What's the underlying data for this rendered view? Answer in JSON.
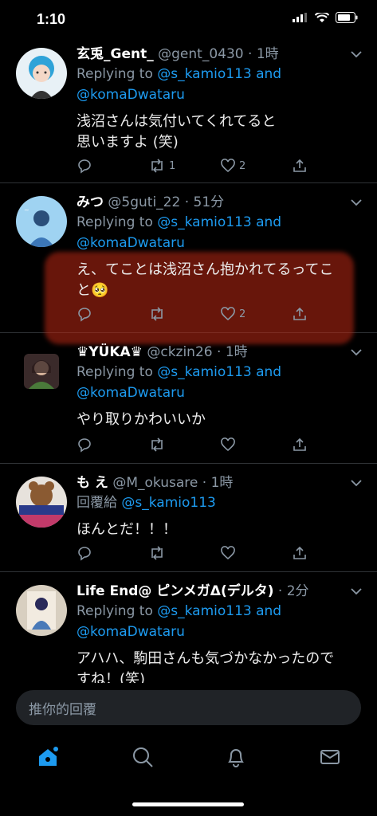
{
  "status": {
    "time": "1:10"
  },
  "tweets": [
    {
      "name": "玄兎_Gent_",
      "handle": "@gent_0430",
      "time": "1時",
      "reply_prefix": "Replying to",
      "mention1": "@s_kamio113",
      "and": "and",
      "mention2": "@komaDwataru",
      "text1": "浅沼さんは気付いてくれてると",
      "text2": "思いますよ (笑)",
      "retweets": "1",
      "likes": "2",
      "avatar_color": "#2fa3d8"
    },
    {
      "name": "みつ",
      "handle": "@5guti_22",
      "time": "51分",
      "reply_prefix": "Replying to",
      "mention1": "@s_kamio113",
      "and": "and",
      "mention2": "@komaDwataru",
      "text1": "え、てことは浅沼さん抱かれてるってこ",
      "text2": "と🥺",
      "retweets": "",
      "likes": "2",
      "avatar_color": "#8cc9ef"
    },
    {
      "name": "♛YÜKA♛",
      "handle": "@ckzin26",
      "time": "1時",
      "reply_prefix": "Replying to",
      "mention1": "@s_kamio113",
      "and": "and",
      "mention2": "@komaDwataru",
      "text1": "やり取りかわいいか",
      "retweets": "",
      "likes": "",
      "avatar_color": "#5a4a4a"
    },
    {
      "name": "も え",
      "handle": "@M_okusare",
      "time": "1時",
      "reply_prefix": "回覆給",
      "mention1": "@s_kamio113",
      "text1": "ほんとだ！！！",
      "retweets": "",
      "likes": "",
      "avatar_color": "#7a5a3a"
    },
    {
      "name": "Life End@ ピンメガΔ(デルタ)",
      "handle": "",
      "time": "2分",
      "reply_prefix": "Replying to",
      "mention1": "@s_kamio113",
      "and": "and",
      "mention2": "@komaDwataru",
      "text1": "アハハ、駒田さんも気づかなかったので",
      "text2": "すね！(笑)",
      "avatar_color": "#d8cfc0"
    }
  ],
  "reply_placeholder": "推你的回覆",
  "colors": {
    "accent": "#1d9bf0",
    "muted": "#8b98a5",
    "highlight": "#be2814"
  },
  "icons": [
    "reply-icon",
    "retweet-icon",
    "like-icon",
    "share-icon",
    "home-icon",
    "search-icon",
    "bell-icon",
    "mail-icon"
  ]
}
